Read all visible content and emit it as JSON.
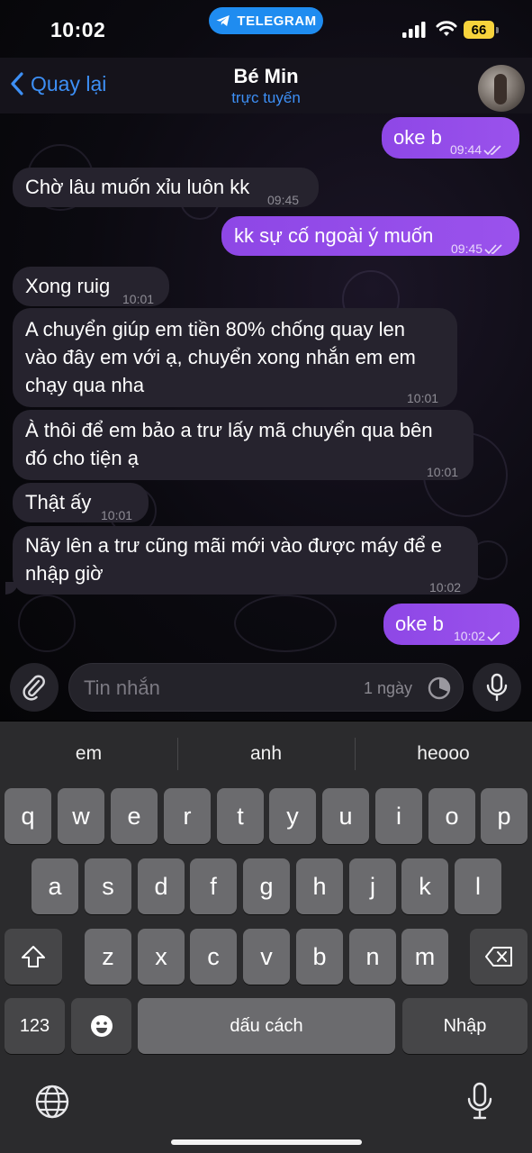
{
  "status_bar": {
    "time": "10:02",
    "app_pill": "TELEGRAM",
    "battery": "66"
  },
  "header": {
    "back_label": "Quay lại",
    "contact_name": "Bé Min",
    "contact_status": "trực tuyến"
  },
  "messages": [
    {
      "dir": "out",
      "text": "oke b",
      "time": "09:44"
    },
    {
      "dir": "in",
      "text": "Chờ lâu muốn xỉu luôn kk",
      "time": "09:45"
    },
    {
      "dir": "out",
      "text": "kk sự cố ngoài ý muốn",
      "time": "09:45"
    },
    {
      "dir": "in",
      "text": "Xong ruig",
      "time": "10:01"
    },
    {
      "dir": "in",
      "lines": [
        "A chuyển giúp em tiền 80% chống quay len",
        "vào đây em với ạ, chuyển xong nhắn em em",
        "chạy qua nha"
      ],
      "time": "10:01"
    },
    {
      "dir": "in",
      "lines": [
        "À thôi để em bảo a trư lấy mã chuyển qua bên",
        "đó cho tiện ạ"
      ],
      "time": "10:01"
    },
    {
      "dir": "in",
      "text": "Thật ấy",
      "time": "10:01"
    },
    {
      "dir": "in",
      "lines": [
        "Nãy lên a trư cũng mãi mới vào được máy để e",
        "nhập giờ"
      ],
      "time": "10:02"
    },
    {
      "dir": "out",
      "text": "oke b",
      "time": "10:02"
    }
  ],
  "composer": {
    "placeholder": "Tin nhắn",
    "timer_label": "1 ngày"
  },
  "keyboard": {
    "suggestions": [
      "em",
      "anh",
      "heooo"
    ],
    "row1": [
      "q",
      "w",
      "e",
      "r",
      "t",
      "y",
      "u",
      "i",
      "o",
      "p"
    ],
    "row2": [
      "a",
      "s",
      "d",
      "f",
      "g",
      "h",
      "j",
      "k",
      "l"
    ],
    "row3": [
      "z",
      "x",
      "c",
      "v",
      "b",
      "n",
      "m"
    ],
    "numbers_key": "123",
    "space_key": "dấu cách",
    "return_key": "Nhập"
  },
  "colors": {
    "accent": "#3d8ff5",
    "outgoing_bubble": "#9a52ec",
    "incoming_bubble": "#26232e",
    "telegram_pill": "#1f8cf0",
    "battery": "#f7d33c"
  }
}
